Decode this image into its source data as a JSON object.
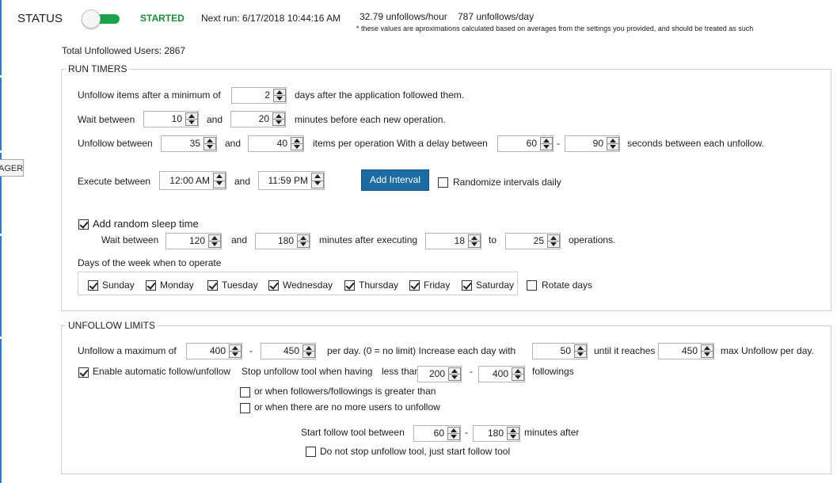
{
  "header": {
    "status_label": "STATUS",
    "status_value": "STARTED",
    "next_run": "Next run: 6/17/2018 10:44:16 AM",
    "unfollows_hour": "32.79 unfollows/hour",
    "unfollows_day": "787 unfollows/day",
    "note": "* these values are aproximations calculated based on averages from the settings you provided, and should be treated as such",
    "toggle_on": true
  },
  "side_tab": "AGER",
  "total_unfollowed": "Total Unfollowed Users: 2867",
  "run_timers": {
    "title": "RUN TIMERS",
    "min_days_label": "Unfollow items after a minimum of",
    "min_days": "2",
    "min_days_suffix": "days after the application followed them.",
    "wait_label": "Wait between",
    "wait_min": "10",
    "and1": "and",
    "wait_max": "20",
    "wait_suffix": "minutes before each new operation.",
    "unfollow_between_label": "Unfollow between",
    "items_min": "35",
    "and2": "and",
    "items_max": "40",
    "items_suffix": "items per operation  With a delay between",
    "delay_min": "60",
    "dash1": "-",
    "delay_max": "90",
    "delay_suffix": "seconds between each unfollow.",
    "execute_label": "Execute between",
    "exec_start": "12:00 AM",
    "and3": "and",
    "exec_end": "11:59 PM",
    "add_interval": "Add Interval",
    "randomize_label": "Randomize intervals daily",
    "randomize_checked": false,
    "random_sleep_label": "Add random sleep time",
    "random_sleep_checked": true,
    "sleep_wait_label": "Wait between",
    "sleep_min": "120",
    "and4": "and",
    "sleep_max": "180",
    "sleep_mid": "minutes after executing",
    "ops_min": "18",
    "to": "to",
    "ops_max": "25",
    "ops_suffix": "operations.",
    "days_label": "Days of the week when to operate",
    "days": [
      {
        "label": "Sunday",
        "checked": true
      },
      {
        "label": "Monday",
        "checked": true
      },
      {
        "label": "Tuesday",
        "checked": true
      },
      {
        "label": "Wednesday",
        "checked": true
      },
      {
        "label": "Thursday",
        "checked": true
      },
      {
        "label": "Friday",
        "checked": true
      },
      {
        "label": "Saturday",
        "checked": true
      }
    ],
    "rotate_days_label": "Rotate days",
    "rotate_days_checked": false
  },
  "limits": {
    "title": "UNFOLLOW LIMITS",
    "max_label": "Unfollow a maximum of",
    "max_min": "400",
    "dash2": "-",
    "max_max": "450",
    "per_day": "per day. (0 = no limit)  Increase each day with",
    "increase": "50",
    "until": "until it reaches",
    "reach": "450",
    "max_suffix": "max Unfollow per day.",
    "auto_label": "Enable automatic follow/unfollow",
    "auto_checked": true,
    "stop_label": "Stop unfollow tool when having",
    "less_than": "less than",
    "less_min": "200",
    "dash3": "-",
    "less_max": "400",
    "followings": "followings",
    "or_greater_label": "or when followers/followings is greater than",
    "or_greater_checked": false,
    "or_no_more_label": "or when there are no more users to unfollow",
    "or_no_more_checked": false,
    "start_follow_label": "Start follow tool between",
    "start_min": "60",
    "dash4": "-",
    "start_max": "180",
    "minutes_after": "minutes after",
    "do_not_stop_label": "Do not stop unfollow tool, just start follow tool",
    "do_not_stop_checked": false
  }
}
